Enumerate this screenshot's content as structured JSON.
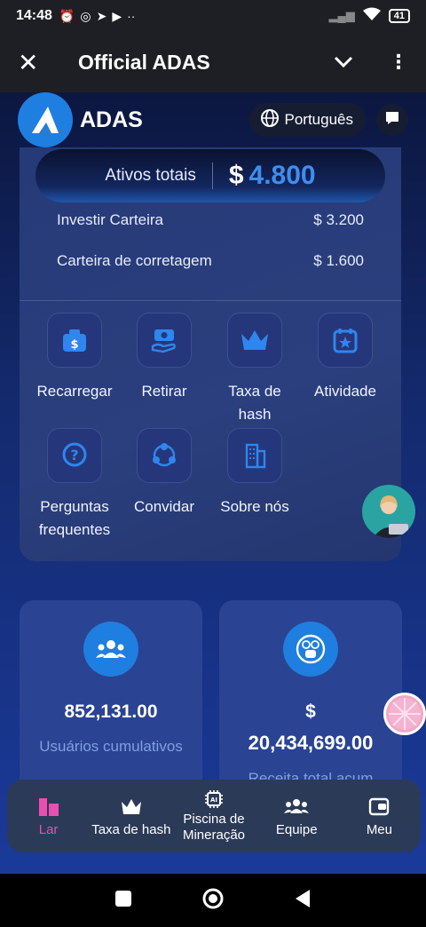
{
  "status_bar": {
    "time": "14:48",
    "battery": "41"
  },
  "app_bar": {
    "title": "Official ADAS"
  },
  "site": {
    "brand": "ADAS",
    "language": "Português"
  },
  "wallet": {
    "total_label": "Ativos totais",
    "total_currency": "$",
    "total_value": "4.800",
    "rows": [
      {
        "label": "Investir Carteira",
        "value": "$ 3.200"
      },
      {
        "label": "Carteira de corretagem",
        "value": "$ 1.600"
      }
    ]
  },
  "actions": [
    {
      "label": "Recarregar",
      "icon": "wallet-dollar-icon"
    },
    {
      "label": "Retirar",
      "icon": "cash-hand-icon"
    },
    {
      "label": "Taxa de hash",
      "icon": "crown-icon"
    },
    {
      "label": "Atividade",
      "icon": "calendar-star-icon"
    },
    {
      "label": "Perguntas frequentes",
      "icon": "question-icon"
    },
    {
      "label": "Convidar",
      "icon": "share-nodes-icon"
    },
    {
      "label": "Sobre nós",
      "icon": "building-icon"
    }
  ],
  "stats": [
    {
      "value": "852,131.00",
      "label": "Usuários cumulativos",
      "icon": "users-icon"
    },
    {
      "value_prefix": "$",
      "value": "20,434,699.00",
      "label": "Receita total acum",
      "icon": "money-bag-icon"
    }
  ],
  "tabs": [
    {
      "label": "Lar",
      "icon": "home-icon",
      "active": true
    },
    {
      "label": "Taxa de hash",
      "icon": "crown-icon",
      "active": false
    },
    {
      "label": "Piscina de Mineração",
      "icon": "ai-chip-icon",
      "active": false
    },
    {
      "label": "Equipe",
      "icon": "team-icon",
      "active": false
    },
    {
      "label": "Meu",
      "icon": "wallet-icon",
      "active": false
    }
  ],
  "colors": {
    "accent_blue": "#3d8ef0",
    "active_tab": "#e84fb0",
    "stat_label": "#7fa0e0"
  }
}
